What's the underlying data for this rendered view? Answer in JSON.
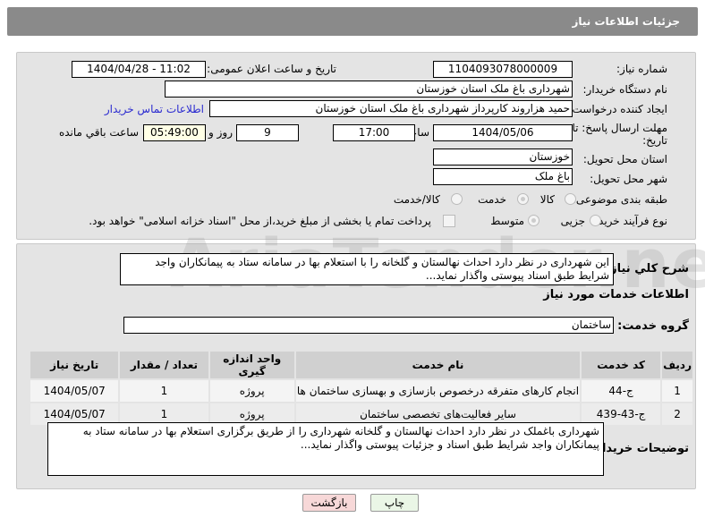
{
  "header": {
    "title": "جزئیات اطلاعات نیاز"
  },
  "form": {
    "need_number_label": "شماره نیاز:",
    "need_number": "1104093078000009",
    "announce_label": "تاریخ و ساعت اعلان عمومی:",
    "announce_value": "1404/04/28 - 11:02",
    "buyer_label": "نام دستگاه خریدار:",
    "buyer": "شهرداری باغ ملک استان خوزستان",
    "creator_label": "ایجاد کننده درخواست:",
    "creator": "حمید هزاروند کارپرداز شهرداری باغ ملک استان خوزستان",
    "contact_link": "اطلاعات تماس خریدار",
    "deadline_label": "مهلت ارسال پاسخ: تا تاریخ:",
    "deadline_date": "1404/05/06",
    "time_label": "ساعت",
    "deadline_time": "17:00",
    "days": "9",
    "days_label": "روز و",
    "remaining": "05:49:00",
    "remaining_label": "ساعت باقي مانده",
    "province_label": "استان محل تحویل:",
    "province": "خوزستان",
    "city_label": "شهر محل تحویل:",
    "city": "باغ ملک",
    "category_label": "طبقه بندی موضوعی:",
    "category_options": [
      "کالا",
      "خدمت",
      "کالا/خدمت"
    ],
    "process_label": "نوع فرآیند خرید :",
    "process_options": [
      "جزیی",
      "متوسط"
    ],
    "payment_text": "پرداخت تمام یا بخشی از مبلغ خرید،از محل \"اسناد خزانه اسلامی\" خواهد بود."
  },
  "details": {
    "summary_label": "شرح کلي نياز:",
    "summary": "این شهرداری در نظر دارد احداث نهالستان و گلخانه را با استعلام بها در سامانه ستاد به پیمانکاران واجد شرایط طبق اسناد پیوستی واگذار نماید...",
    "services_title": "اطلاعات خدمات مورد نیاز",
    "group_label": "گروه خدمت:",
    "group": "ساختمان",
    "table": {
      "headers": [
        "ردیف",
        "کد خدمت",
        "نام خدمت",
        "واحد اندازه گیری",
        "تعداد / مقدار",
        "تاریخ نیاز"
      ],
      "rows": [
        [
          "1",
          "ج-44",
          "انجام کارهای متفرقه درخصوص بازسازی و بهسازی ساختمان ها",
          "پروژه",
          "1",
          "1404/05/07"
        ],
        [
          "2",
          "ج-43-439",
          "سایر فعالیت‌های تخصصی ساختمان",
          "پروژه",
          "1",
          "1404/05/07"
        ]
      ]
    },
    "buyer_notes_label": "توضیحات خریدار:",
    "buyer_notes": "شهرداری باغملک در نظر دارد احداث نهالستان و گلخانه شهرداری را از طریق برگزاری استعلام بها در سامانه ستاد به پیمانکاران واجد شرایط طبق اسناد و جزئیات پیوستی واگذار نماید..."
  },
  "buttons": {
    "print": "چاپ",
    "back": "بازگشت"
  },
  "watermark": "AriaTender.net"
}
